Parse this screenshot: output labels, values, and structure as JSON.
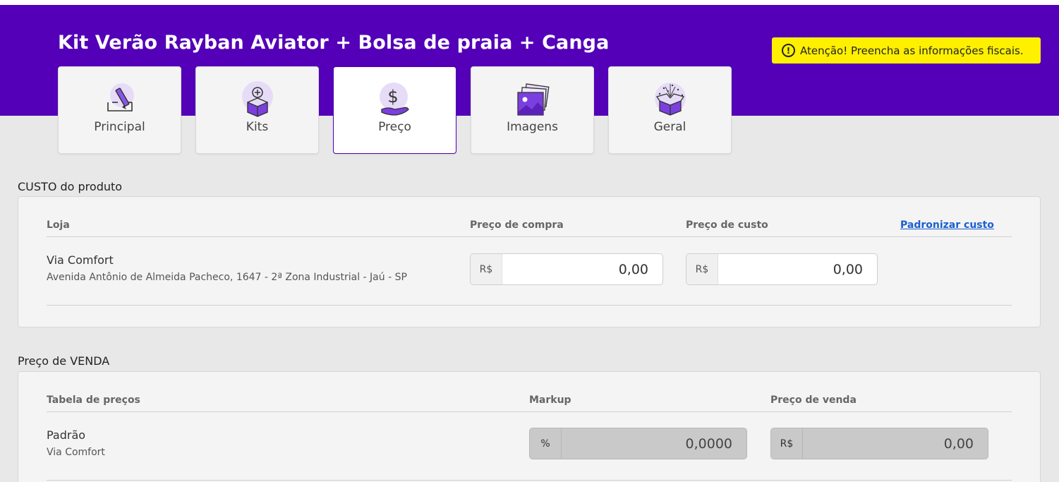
{
  "page": {
    "title": "Kit Verão Rayban Aviator + Bolsa de praia + Canga"
  },
  "alert": {
    "text": "Atenção! Preencha as informações fiscais.",
    "icon": "exclamation-circle-icon",
    "color": "#fff000"
  },
  "theme": {
    "header_color": "#5300b8",
    "link_color": "#1a5fd0"
  },
  "tabs": [
    {
      "label": "Principal",
      "icon": "pencil-box-icon",
      "active": false
    },
    {
      "label": "Kits",
      "icon": "box-plus-icon",
      "active": false
    },
    {
      "label": "Preço",
      "icon": "money-hand-icon",
      "active": true
    },
    {
      "label": "Imagens",
      "icon": "images-icon",
      "active": false
    },
    {
      "label": "Geral",
      "icon": "sparkle-box-icon",
      "active": false
    }
  ],
  "cost": {
    "section_title": "CUSTO do produto",
    "headers": {
      "store": "Loja",
      "purchase_price": "Preço de compra",
      "cost_price": "Preço de custo",
      "standardize_link": "Padronizar custo"
    },
    "row": {
      "store_name": "Via Comfort",
      "address": "Avenida Antônio de Almeida Pacheco, 1647 - 2ª Zona Industrial - Jaú - SP",
      "currency": "R$",
      "purchase_price": "0,00",
      "cost_price": "0,00"
    }
  },
  "sale": {
    "section_title": "Preço de VENDA",
    "headers": {
      "price_table": "Tabela de preços",
      "markup": "Markup",
      "sale_price": "Preço de venda"
    },
    "row": {
      "table_name": "Padrão",
      "store": "Via Comfort",
      "markup_prefix": "%",
      "markup": "0,0000",
      "currency": "R$",
      "sale_price": "0,00"
    }
  }
}
